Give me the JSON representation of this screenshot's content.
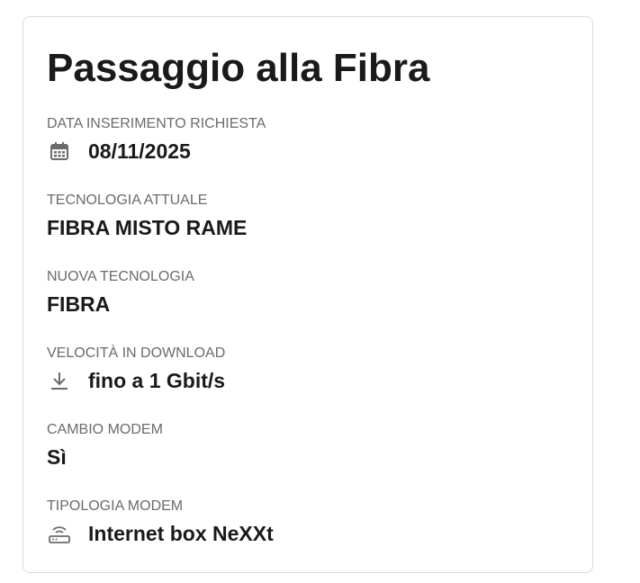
{
  "card": {
    "title": "Passaggio alla Fibra",
    "fields": [
      {
        "label": "DATA INSERIMENTO RICHIESTA",
        "value": "08/11/2025",
        "icon": "calendar-icon"
      },
      {
        "label": "TECNOLOGIA ATTUALE",
        "value": "FIBRA MISTO RAME"
      },
      {
        "label": "NUOVA TECNOLOGIA",
        "value": "FIBRA"
      },
      {
        "label": "VELOCITÀ IN DOWNLOAD",
        "value": "fino a 1 Gbit/s",
        "icon": "download-icon"
      },
      {
        "label": "CAMBIO MODEM",
        "value": "Sì"
      },
      {
        "label": "TIPOLOGIA MODEM",
        "value": "Internet box NeXXt",
        "icon": "router-icon"
      }
    ]
  },
  "colors": {
    "title": "#1a1a1a",
    "label": "#6b6b6b",
    "value": "#1a1a1a",
    "icon": "#6b6b6b",
    "border": "#dcdcdc"
  }
}
